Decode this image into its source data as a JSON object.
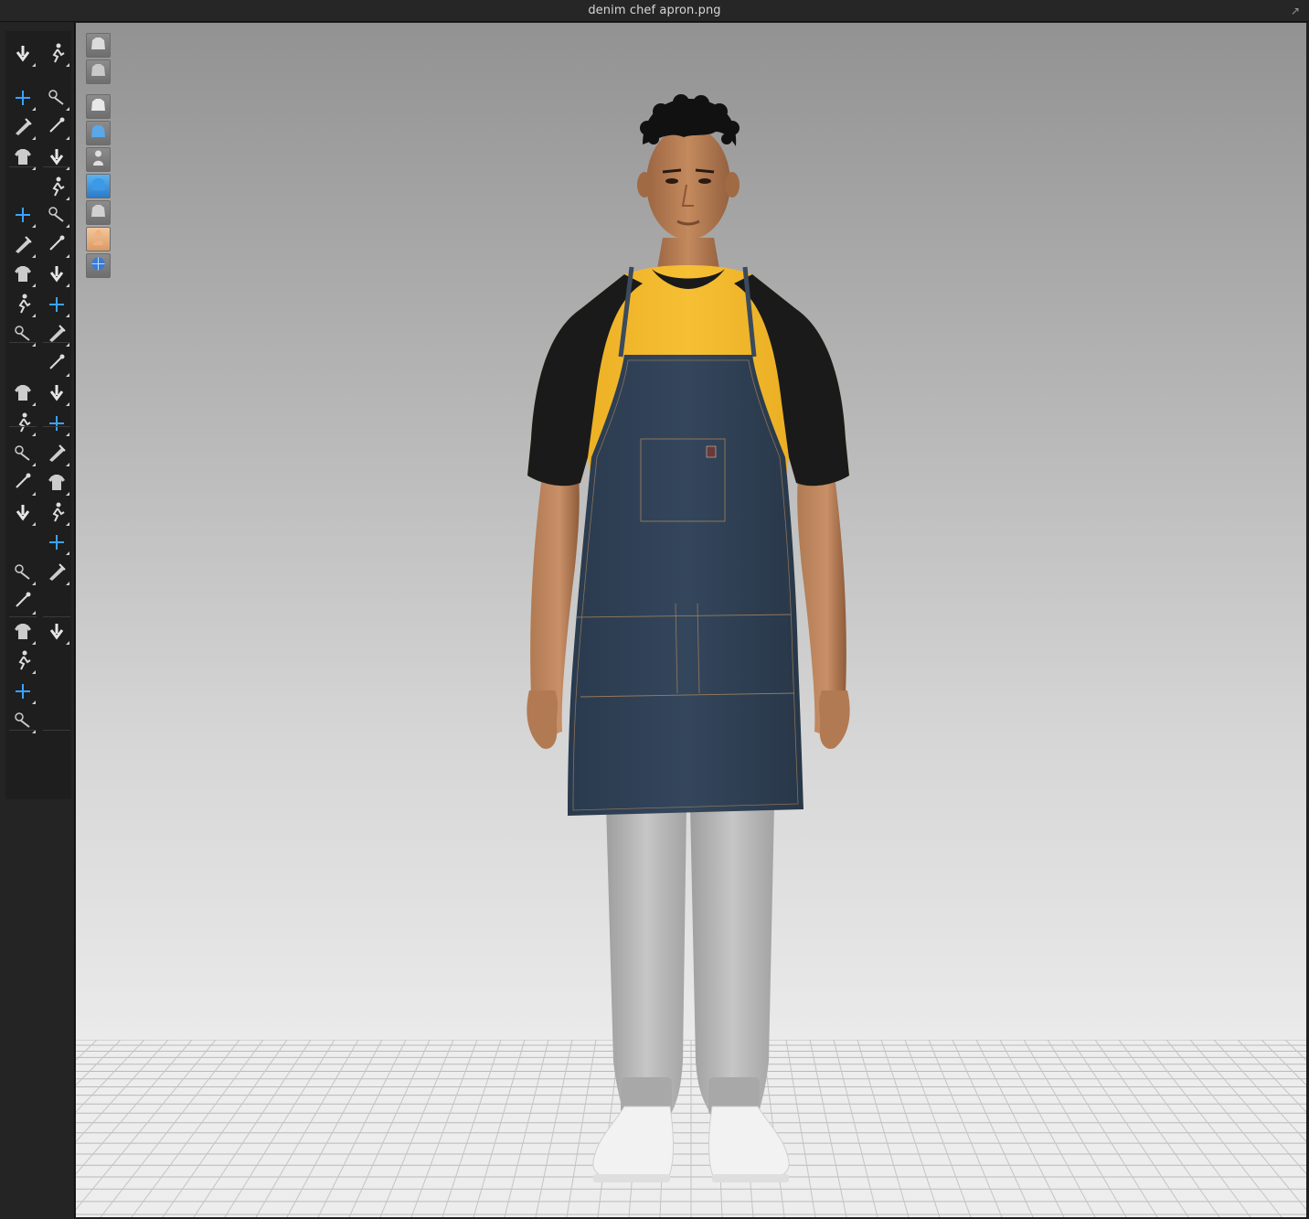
{
  "window": {
    "title": "denim chef apron.png",
    "popout_icon": "popout-icon"
  },
  "toolbar": {
    "tools": [
      {
        "name": "select-move-tool",
        "icon": "arrow-down-icon"
      },
      {
        "name": "avatar-pose-tool",
        "icon": "walking-figure-icon"
      },
      {
        "name": "transform-pattern-tool",
        "icon": "crosshair-icon"
      },
      {
        "name": "edit-curve-tool",
        "icon": "curve-pin-icon"
      },
      {
        "name": "select-mesh-tool",
        "icon": "mesh-brush-icon"
      },
      {
        "name": "pin-tool",
        "icon": "pin-icon"
      },
      {
        "name": "garment-select-tool",
        "icon": "shirt-icon"
      },
      {
        "name": "tack-tool",
        "icon": "tack-icon"
      },
      {
        "name": "stitch-tool",
        "icon": "fold-icon"
      },
      {
        "name": "segment-sewing-tool",
        "icon": "sew-segment-icon"
      },
      {
        "name": "measure-tool",
        "icon": "measure-icon"
      },
      {
        "name": "free-sewing-tool",
        "icon": "free-sew-icon"
      },
      {
        "name": "fold-arrangement-tool",
        "icon": "fold-arrange-icon"
      },
      {
        "name": "texture-tool",
        "icon": "texture-icon"
      },
      {
        "name": "puckering-tool",
        "icon": "pucker-icon"
      },
      {
        "name": "graphic-tool",
        "icon": "graphic-icon"
      },
      {
        "name": "trim-tool",
        "icon": "trim-icon"
      },
      {
        "name": "topstitch-tool",
        "icon": "needle-icon"
      },
      {
        "name": "button-tool",
        "icon": "button-icon"
      },
      {
        "name": "select-button-tool",
        "icon": "select-button-icon"
      },
      {
        "name": "button-hole-tool",
        "icon": "buttonhole-icon"
      },
      {
        "name": "pattern-layer-tool",
        "icon": "layer-icon"
      },
      {
        "name": "lock-tool",
        "icon": "lock-icon"
      },
      {
        "name": "jacket-tool",
        "icon": "jacket-icon"
      },
      {
        "name": "zipper-tool",
        "icon": "zipper-icon"
      },
      {
        "name": "tshirt-tool",
        "icon": "tshirt-icon"
      },
      {
        "name": "zip-pull-tool",
        "icon": "zip-pull-icon"
      },
      {
        "name": "gift-tool",
        "icon": "bundle-icon"
      },
      {
        "name": "shrinkage-tool",
        "icon": "shrink-icon"
      },
      {
        "name": "ruler-tool",
        "icon": "ruler-icon"
      },
      {
        "name": "fabric-tool",
        "icon": "fabric-icon"
      },
      {
        "name": "avatar-tool",
        "icon": "avatar-icon"
      },
      {
        "name": "size-grading-tool",
        "icon": "size-grade-icon"
      },
      {
        "name": "panel-tool",
        "icon": "panel-icon"
      },
      {
        "name": "measure-avatar-tool",
        "icon": "measure-avatar-icon"
      },
      {
        "name": "merge-tool",
        "icon": "merge-icon"
      },
      {
        "name": "pencil-tool",
        "icon": "pencil-icon"
      },
      {
        "name": "fit-map-tool",
        "icon": "fit-map-icon"
      },
      {
        "name": "garment-fit-tool",
        "icon": "garment-fit-icon"
      }
    ]
  },
  "view_controls": [
    {
      "name": "view-3d-garment",
      "icon": "garment-view-icon"
    },
    {
      "name": "view-garment-thickness",
      "icon": "thickness-view-icon"
    },
    {
      "name": "view-show-garment",
      "icon": "show-garment-icon"
    },
    {
      "name": "view-show-pattern",
      "icon": "show-pattern-icon"
    },
    {
      "name": "view-show-avatar",
      "icon": "show-avatar-icon"
    },
    {
      "name": "view-texture-surface",
      "icon": "texture-surface-icon"
    },
    {
      "name": "view-shaded",
      "icon": "shaded-view-icon"
    },
    {
      "name": "view-avatar-skin",
      "icon": "avatar-skin-icon"
    },
    {
      "name": "view-environment",
      "icon": "globe-icon"
    }
  ],
  "colors": {
    "apron_denim": "#2e3f54",
    "tshirt_yellow": "#f2b626",
    "tshirt_black": "#1a1a1a",
    "joggers_grey": "#b8b8b8",
    "skin": "#b47a52",
    "active_tool": "#3aa2ff"
  }
}
